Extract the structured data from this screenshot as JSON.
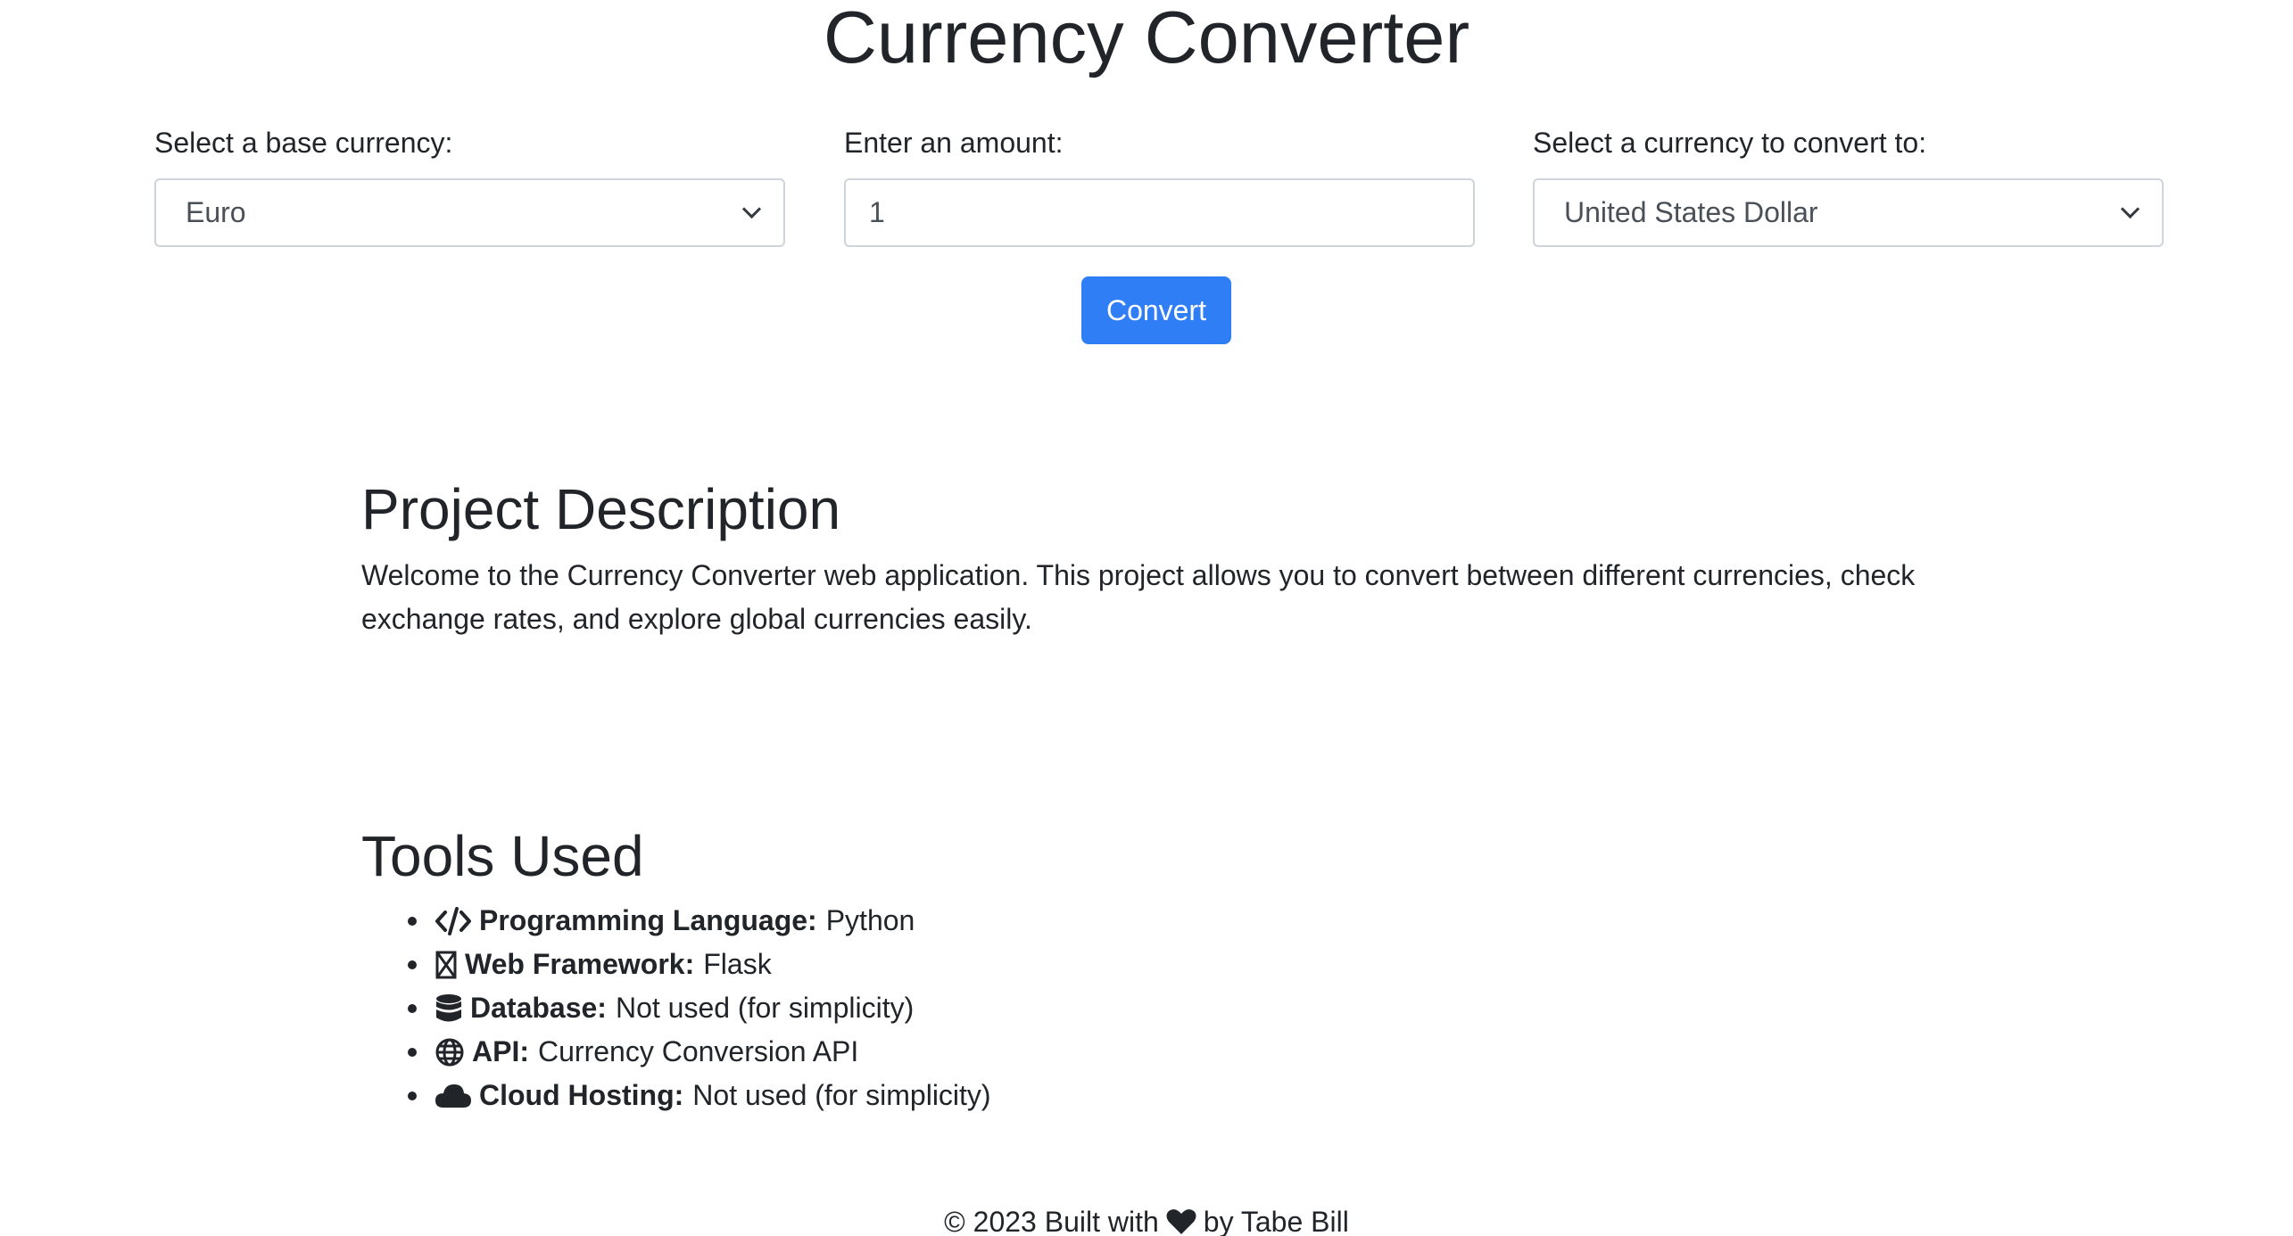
{
  "header": {
    "title": "Currency Converter"
  },
  "form": {
    "base_label": "Select a base currency:",
    "base_value": "Euro",
    "amount_label": "Enter an amount:",
    "amount_value": "1",
    "target_label": "Select a currency to convert to:",
    "target_value": "United States Dollar",
    "convert_label": "Convert"
  },
  "description": {
    "heading": "Project Description",
    "text": "Welcome to the Currency Converter web application. This project allows you to convert between different currencies, check exchange rates, and explore global currencies easily."
  },
  "tools": {
    "heading": "Tools Used",
    "items": [
      {
        "icon": "code-icon",
        "label": "Programming Language:",
        "value": "Python"
      },
      {
        "icon": "flask-icon",
        "label": "Web Framework:",
        "value": "Flask"
      },
      {
        "icon": "database-icon",
        "label": "Database:",
        "value": "Not used (for simplicity)"
      },
      {
        "icon": "globe-icon",
        "label": "API:",
        "value": "Currency Conversion API"
      },
      {
        "icon": "cloud-icon",
        "label": "Cloud Hosting:",
        "value": "Not used (for simplicity)"
      }
    ]
  },
  "footer": {
    "prefix": "© 2023 Built with",
    "icon": "heart-icon",
    "suffix": "by Tabe Bill"
  },
  "colors": {
    "primary": "#2f7ef6",
    "text": "#212529",
    "border": "#ced4da"
  }
}
